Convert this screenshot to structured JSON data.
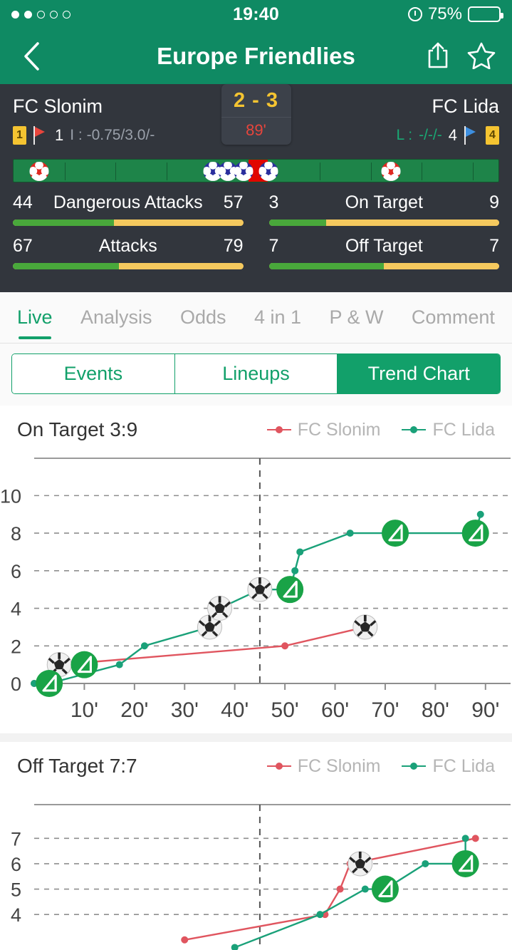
{
  "status_bar": {
    "signal_dots_total": 5,
    "signal_dots_filled": 2,
    "time": "19:40",
    "battery_percent": "75%",
    "battery_level": 75,
    "alarm_icon": "alarm-clock-icon"
  },
  "nav": {
    "back_icon": "chevron-left-icon",
    "title": "Europe Friendlies",
    "share_icon": "share-icon",
    "favorite_icon": "star-outline-icon"
  },
  "match": {
    "home_team": "FC Slonim",
    "away_team": "FC Lida",
    "score": "2 - 3",
    "minute": "89'",
    "home_card": "1",
    "home_corners": "1",
    "home_odds": "I : -0.75/3.0/-",
    "away_label": "L :",
    "away_odds": "-/-/-",
    "away_corners": "4",
    "away_card": "4"
  },
  "timeline": {
    "events": [
      {
        "type": "goal-home",
        "minute": 5
      },
      {
        "type": "goal-away",
        "minute": 39
      },
      {
        "type": "goal-away",
        "minute": 42
      },
      {
        "type": "goal-away",
        "minute": 45
      },
      {
        "type": "goal-away",
        "minute": 50
      },
      {
        "type": "goal-home",
        "minute": 74
      }
    ],
    "current_minute": 89
  },
  "stats": [
    {
      "label": "Dangerous Attacks",
      "home": "44",
      "away": "57",
      "home_pct": 44
    },
    {
      "label": "On Target",
      "home": "3",
      "away": "9",
      "home_pct": 25
    },
    {
      "label": "Attacks",
      "home": "67",
      "away": "79",
      "home_pct": 46
    },
    {
      "label": "Off Target",
      "home": "7",
      "away": "7",
      "home_pct": 50
    }
  ],
  "main_tabs": [
    {
      "label": "Live",
      "active": true
    },
    {
      "label": "Analysis",
      "active": false
    },
    {
      "label": "Odds",
      "active": false
    },
    {
      "label": "4 in 1",
      "active": false
    },
    {
      "label": "P & W",
      "active": false
    },
    {
      "label": "Comment",
      "active": false
    }
  ],
  "sub_tabs": [
    {
      "label": "Events",
      "active": false
    },
    {
      "label": "Lineups",
      "active": false
    },
    {
      "label": "Trend Chart",
      "active": true
    }
  ],
  "legend": {
    "home": "FC Slonim",
    "away": "FC Lida"
  },
  "colors": {
    "brand_green": "#0f8a63",
    "accent_green": "#12a06a",
    "series_home": "#e0555f",
    "series_away": "#1aa179",
    "score_yellow": "#f5c431",
    "minute_red": "#e8453c",
    "panel_dark": "#32363d",
    "bar_green": "#49a83b",
    "bar_yellow": "#f5c95e"
  },
  "chart_data": [
    {
      "type": "line",
      "title": "On Target 3:9",
      "xlabel": "",
      "ylabel": "",
      "xlim": [
        0,
        95
      ],
      "ylim": [
        0,
        11
      ],
      "yticks": [
        0,
        2,
        4,
        6,
        8,
        10
      ],
      "xticks": [
        10,
        20,
        30,
        40,
        50,
        60,
        70,
        80,
        90
      ],
      "xtick_labels": [
        "10'",
        "20'",
        "30'",
        "40'",
        "50'",
        "60'",
        "70'",
        "80'",
        "90'"
      ],
      "grid": true,
      "halftime_line": 45,
      "legend_position": "top-right",
      "series": [
        {
          "name": "FC Slonim",
          "color": "#e0555f",
          "x": [
            0,
            5,
            50,
            66
          ],
          "y": [
            0,
            1,
            2,
            3
          ],
          "markers": [
            {
              "x": 5,
              "y": 1,
              "icon": "football-icon"
            },
            {
              "x": 66,
              "y": 3,
              "icon": "football-icon"
            }
          ]
        },
        {
          "name": "FC Lida",
          "color": "#1aa179",
          "x": [
            0,
            3,
            17,
            22,
            35,
            37,
            45,
            51,
            52,
            53,
            63,
            72,
            88,
            89
          ],
          "y": [
            0,
            0,
            1,
            2,
            3,
            4,
            5,
            5,
            6,
            7,
            8,
            8,
            8,
            9
          ],
          "markers": [
            {
              "x": 3,
              "y": 0,
              "icon": "corner-flag-icon"
            },
            {
              "x": 10,
              "y": 1,
              "icon": "corner-flag-icon"
            },
            {
              "x": 35,
              "y": 3,
              "icon": "football-icon"
            },
            {
              "x": 37,
              "y": 4,
              "icon": "football-icon"
            },
            {
              "x": 45,
              "y": 5,
              "icon": "football-icon"
            },
            {
              "x": 51,
              "y": 5,
              "icon": "corner-flag-icon"
            },
            {
              "x": 72,
              "y": 8,
              "icon": "corner-flag-icon"
            },
            {
              "x": 88,
              "y": 8,
              "icon": "corner-flag-icon"
            }
          ]
        }
      ]
    },
    {
      "type": "line",
      "title": "Off Target 7:7",
      "xlabel": "",
      "ylabel": "",
      "xlim": [
        0,
        95
      ],
      "ylim": [
        2.6,
        7.6
      ],
      "yticks": [
        4,
        5,
        6,
        7
      ],
      "xticks": [],
      "xtick_labels": [],
      "grid": true,
      "halftime_line": 45,
      "legend_position": "top-right",
      "series": [
        {
          "name": "FC Slonim",
          "color": "#e0555f",
          "x": [
            30,
            58,
            61,
            63,
            88
          ],
          "y": [
            3,
            4,
            5,
            6,
            7
          ],
          "markers": [
            {
              "x": 65,
              "y": 6,
              "icon": "football-icon"
            }
          ]
        },
        {
          "name": "FC Lida",
          "color": "#1aa179",
          "x": [
            40,
            57,
            66,
            70,
            78,
            86,
            86
          ],
          "y": [
            2.7,
            4,
            5,
            5,
            6,
            6,
            7
          ],
          "markers": [
            {
              "x": 70,
              "y": 5,
              "icon": "corner-flag-icon"
            },
            {
              "x": 86,
              "y": 6,
              "icon": "corner-flag-icon"
            }
          ]
        }
      ]
    }
  ]
}
